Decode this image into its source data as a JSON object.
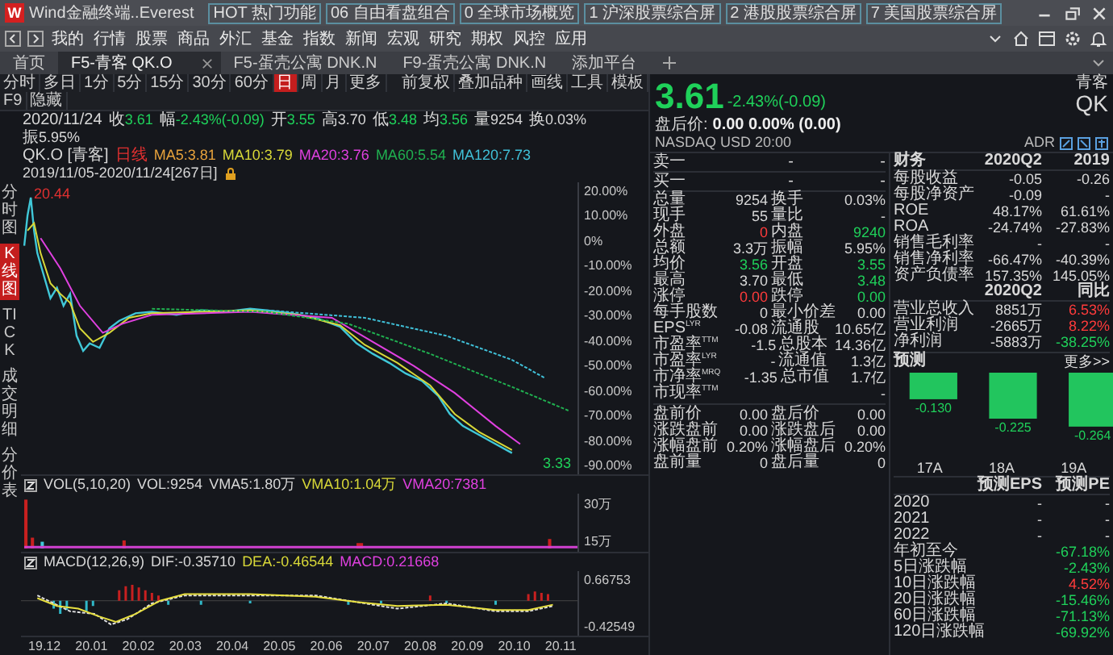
{
  "window": {
    "logo": "W",
    "title": "Wind金融终端..Everest"
  },
  "hot_tabs": [
    "HOT 热门功能",
    "06 自由看盘组合",
    "0 全球市场概览",
    "1 沪深股票综合屏",
    "2 港股股票综合屏",
    "7 美国股票综合屏"
  ],
  "menu": [
    "我的",
    "行情",
    "股票",
    "商品",
    "外汇",
    "基金",
    "指数",
    "新闻",
    "宏观",
    "研究",
    "期权",
    "风控",
    "应用"
  ],
  "doc_tabs": [
    {
      "label": "首页",
      "selected": false
    },
    {
      "label": "F5-青客 QK.O",
      "selected": true
    },
    {
      "label": "F5-蛋壳公寓 DNK.N",
      "selected": false
    },
    {
      "label": "F9-蛋壳公寓 DNK.N",
      "selected": false
    },
    {
      "label": "添加平台",
      "selected": false
    }
  ],
  "periods": [
    {
      "label": "分时",
      "selected": false
    },
    {
      "label": "多日",
      "selected": false
    },
    {
      "label": "1分",
      "selected": false
    },
    {
      "label": "5分",
      "selected": false
    },
    {
      "label": "15分",
      "selected": false
    },
    {
      "label": "30分",
      "selected": false
    },
    {
      "label": "60分",
      "selected": false
    },
    {
      "label": "日",
      "selected": true
    },
    {
      "label": "周",
      "selected": false
    },
    {
      "label": "月",
      "selected": false
    },
    {
      "label": "更多",
      "selected": false
    }
  ],
  "tools": [
    "前复权",
    "叠加品种",
    "画线",
    "工具",
    "模板",
    "F9",
    "隐藏"
  ],
  "info_bar": {
    "date": "2020/11/24",
    "items": [
      {
        "label": "收",
        "value": "3.61",
        "color": "#1fd15a"
      },
      {
        "label": "幅",
        "value": "-2.43%(-0.09)",
        "color": "#1fd15a"
      },
      {
        "label": "开",
        "value": "3.55",
        "color": "#1fd15a"
      },
      {
        "label": "高",
        "value": "3.70",
        "color": "#d8d8d8"
      },
      {
        "label": "低",
        "value": "3.48",
        "color": "#1fd15a"
      },
      {
        "label": "均",
        "value": "3.56",
        "color": "#1fd15a"
      },
      {
        "label": "量",
        "value": "9254",
        "color": "#d8d8d8"
      },
      {
        "label": "换",
        "value": "0.03%",
        "color": "#d8d8d8"
      },
      {
        "label": "振",
        "value": "5.95%",
        "color": "#d8d8d8"
      }
    ]
  },
  "ma_legend": {
    "code": "QK.O [青客]",
    "period": "日线",
    "items": [
      {
        "label": "MA5:3.81",
        "color": "#e8a33c"
      },
      {
        "label": "MA10:3.79",
        "color": "#d8d838"
      },
      {
        "label": "MA20:3.76",
        "color": "#e040e0"
      },
      {
        "label": "MA60:5.54",
        "color": "#20b050"
      },
      {
        "label": "MA120:7.73",
        "color": "#40c0d8"
      }
    ],
    "range": "2019/11/05-2020/11/24[267日]"
  },
  "side_tabs": [
    {
      "label": "分时图",
      "selected": false
    },
    {
      "label": "K线图",
      "selected": true
    },
    {
      "label": "TICK",
      "selected": false
    },
    {
      "label": "成交明细",
      "selected": false
    },
    {
      "label": "分价表",
      "selected": false
    }
  ],
  "main_chart": {
    "yticks": [
      "20.00%",
      "10.00%",
      "0%",
      "-10.00%",
      "-20.00%",
      "-30.00%",
      "-40.00%",
      "-50.00%",
      "-60.00%",
      "-70.00%",
      "-80.00%",
      "-90.00%"
    ],
    "high_label": "20.44",
    "last_label": "3.33"
  },
  "volume": {
    "legend": [
      {
        "label": "VOL(5,10,20)",
        "color": "#d8d8d8"
      },
      {
        "label": "VOL:9254",
        "color": "#d8d8d8"
      },
      {
        "label": "VMA5:1.80万",
        "color": "#d8d8d8"
      },
      {
        "label": "VMA10:1.04万",
        "color": "#d8d838"
      },
      {
        "label": "VMA20:7381",
        "color": "#e040e0"
      }
    ],
    "yticks": [
      "30万",
      "15万"
    ]
  },
  "macd": {
    "legend": [
      {
        "label": "MACD(12,26,9)",
        "color": "#d8d8d8"
      },
      {
        "label": "DIF:-0.35710",
        "color": "#d8d8d8"
      },
      {
        "label": "DEA:-0.46544",
        "color": "#d8d838"
      },
      {
        "label": "MACD:0.21668",
        "color": "#e040e0"
      }
    ],
    "yticks": [
      "0.66753",
      "-0.42549"
    ]
  },
  "x_labels": [
    "19.12",
    "20.01",
    "20.02",
    "20.03",
    "20.04",
    "20.05",
    "20.06",
    "20.07",
    "20.08",
    "20.09",
    "20.10",
    "20.11"
  ],
  "quote": {
    "price": "3.61",
    "change": "-2.43%(-0.09)",
    "name": "青客",
    "ticker": "QK",
    "after_hours_label": "盘后价:",
    "after_hours": "0.00 0.00% (0.00)",
    "exchange": "NASDAQ USD 20:00",
    "adr": "ADR"
  },
  "order_book": [
    {
      "label": "卖一",
      "price": "-",
      "volume": "-"
    },
    {
      "label": "买一",
      "price": "-",
      "volume": "-"
    }
  ],
  "stats": [
    {
      "left": {
        "label": "总量",
        "value": "9254",
        "color": "#d8d8d8"
      },
      "right": {
        "label": "换手",
        "value": "0.03%",
        "color": "#d8d8d8"
      }
    },
    {
      "left": {
        "label": "现手",
        "value": "55",
        "color": "#d8d8d8"
      },
      "right": {
        "label": "量比",
        "value": "-"
      }
    },
    {
      "left": {
        "label": "外盘",
        "value": "0",
        "color": "#ff3b3b"
      },
      "right": {
        "label": "内盘",
        "value": "9240",
        "color": "#1fd15a"
      }
    },
    {
      "left": {
        "label": "总额",
        "value": "3.3万",
        "color": "#d8d8d8"
      },
      "right": {
        "label": "振幅",
        "value": "5.95%",
        "color": "#d8d8d8"
      }
    },
    {
      "left": {
        "label": "均价",
        "value": "3.56",
        "color": "#1fd15a"
      },
      "right": {
        "label": "开盘",
        "value": "3.55",
        "color": "#1fd15a"
      }
    },
    {
      "left": {
        "label": "最高",
        "value": "3.70",
        "color": "#d8d8d8"
      },
      "right": {
        "label": "最低",
        "value": "3.48",
        "color": "#1fd15a"
      }
    },
    {
      "left": {
        "label": "涨停",
        "value": "0.00",
        "color": "#ff3b3b"
      },
      "right": {
        "label": "跌停",
        "value": "0.00",
        "color": "#1fd15a"
      }
    },
    {
      "left": {
        "label": "每手股数",
        "value": "0",
        "color": "#d8d8d8"
      },
      "right": {
        "label": "最小价差",
        "value": "0.00",
        "color": "#d8d8d8"
      }
    },
    {
      "left": {
        "label": "EPS$^{LYR}$",
        "value": "-0.08",
        "color": "#d8d8d8"
      },
      "right": {
        "label": "流通股",
        "value": "10.65亿",
        "color": "#d8d8d8"
      }
    },
    {
      "left": {
        "label": "市盈率$^{TTM}$",
        "value": "-1.5",
        "color": "#d8d8d8"
      },
      "right": {
        "label": "总股本",
        "value": "14.36亿",
        "color": "#d8d8d8"
      }
    },
    {
      "left": {
        "label": "市盈率$^{LYR}$",
        "value": "-"
      },
      "right": {
        "label": "流通值",
        "value": "1.3亿",
        "color": "#d8d8d8"
      }
    },
    {
      "left": {
        "label": "市净率$^{MRQ}$",
        "value": "-1.35",
        "color": "#d8d8d8"
      },
      "right": {
        "label": "总市值",
        "value": "1.7亿",
        "color": "#d8d8d8"
      }
    },
    {
      "left": {
        "label": "市现率$^{TTM}$",
        "value": "-"
      }
    }
  ],
  "extended_hours": [
    {
      "left": {
        "label": "盘前价",
        "value": "0.00",
        "color": "#d8d8d8"
      },
      "right": {
        "label": "盘后价",
        "value": "0.00",
        "color": "#d8d8d8"
      }
    },
    {
      "left": {
        "label": "涨跌盘前",
        "value": "0.00",
        "color": "#d8d8d8"
      },
      "right": {
        "label": "涨跌盘后",
        "value": "0.00",
        "color": "#d8d8d8"
      }
    },
    {
      "left": {
        "label": "涨幅盘前",
        "value": "0.20%",
        "color": "#d8d8d8"
      },
      "right": {
        "label": "涨幅盘后",
        "value": "0.20%",
        "color": "#d8d8d8"
      }
    },
    {
      "left": {
        "label": "盘前量",
        "value": "0",
        "color": "#d8d8d8"
      },
      "right": {
        "label": "盘后量",
        "value": "0",
        "color": "#d8d8d8"
      }
    }
  ],
  "finance": {
    "title": "财务",
    "columns": [
      "2020Q2",
      "2019"
    ],
    "rows": [
      {
        "label": "每股收益",
        "values": [
          "-0.05",
          "-0.26"
        ]
      },
      {
        "label": "每股净资产",
        "values": [
          "-0.09",
          "-"
        ]
      },
      {
        "label": "ROE",
        "values": [
          "48.17%",
          "61.61%"
        ]
      },
      {
        "label": "ROA",
        "values": [
          "-24.74%",
          "-27.83%"
        ]
      },
      {
        "label": "销售毛利率",
        "values": [
          "-",
          "-"
        ]
      },
      {
        "label": "销售净利率",
        "values": [
          "-66.47%",
          "-40.39%"
        ]
      },
      {
        "label": "资产负债率",
        "values": [
          "157.35%",
          "145.05%"
        ]
      }
    ]
  },
  "growth": {
    "columns": [
      "2020Q2",
      "同比"
    ],
    "rows": [
      {
        "label": "营业总收入",
        "value": "8851万",
        "change": "6.53%",
        "color": "#ff3b3b"
      },
      {
        "label": "营业利润",
        "value": "-2665万",
        "change": "8.22%",
        "color": "#ff3b3b"
      },
      {
        "label": "净利润",
        "value": "-5883万",
        "change": "-38.25%",
        "color": "#1fd15a"
      }
    ]
  },
  "forecast": {
    "title": "预测",
    "more": "更多>>",
    "chart_data": {
      "type": "bar",
      "categories": [
        "17A",
        "18A",
        "19A"
      ],
      "values": [
        -0.13,
        -0.225,
        -0.264
      ],
      "value_labels": [
        "-0.130",
        "-0.225",
        "-0.264"
      ]
    }
  },
  "forecast_table": {
    "columns": [
      "预测EPS",
      "预测PE"
    ],
    "rows": [
      {
        "label": "2020",
        "values": [
          "-",
          "-"
        ]
      },
      {
        "label": "2021",
        "values": [
          "-",
          "-"
        ]
      },
      {
        "label": "2022",
        "values": [
          "-",
          "-"
        ]
      }
    ]
  },
  "performance": [
    {
      "label": "年初至今",
      "value": "-67.18%",
      "color": "#1fd15a"
    },
    {
      "label": "5日涨跌幅",
      "value": "-2.43%",
      "color": "#1fd15a"
    },
    {
      "label": "10日涨跌幅",
      "value": "4.52%",
      "color": "#ff3b3b"
    },
    {
      "label": "20日涨跌幅",
      "value": "-15.46%",
      "color": "#1fd15a"
    },
    {
      "label": "60日涨跌幅",
      "value": "-71.13%",
      "color": "#1fd15a"
    },
    {
      "label": "120日涨跌幅",
      "value": "-69.92%",
      "color": "#1fd15a"
    }
  ]
}
